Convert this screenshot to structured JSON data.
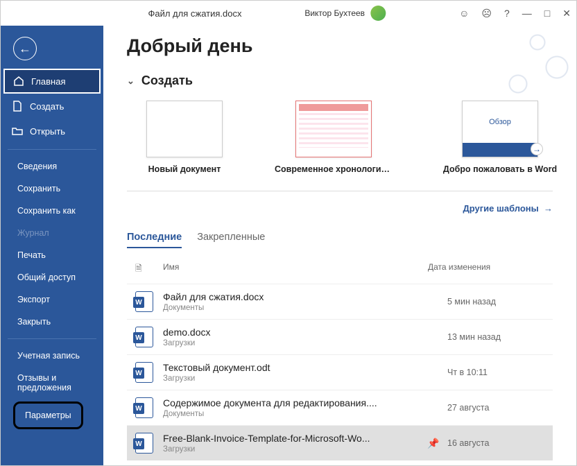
{
  "titlebar": {
    "title": "Файл для сжатия.docx",
    "user": "Виктор Бухтеев"
  },
  "sidebar": {
    "home": "Главная",
    "create": "Создать",
    "open": "Открыть",
    "info": "Сведения",
    "save": "Сохранить",
    "saveas": "Сохранить как",
    "history": "Журнал",
    "print": "Печать",
    "share": "Общий доступ",
    "export": "Экспорт",
    "close": "Закрыть",
    "account": "Учетная запись",
    "feedback": "Отзывы и предложения",
    "options": "Параметры"
  },
  "main": {
    "greeting": "Добрый день",
    "create_section": "Создать",
    "template_overview": "Обзор",
    "templates": [
      "Новый документ",
      "Современное хронологич...",
      "Добро пожаловать в Word"
    ],
    "more_templates": "Другие шаблоны",
    "tabs": {
      "recent": "Последние",
      "pinned": "Закрепленные"
    },
    "cols": {
      "name": "Имя",
      "date": "Дата изменения"
    },
    "files": [
      {
        "name": "Файл для сжатия.docx",
        "loc": "Документы",
        "date": "5 мин назад"
      },
      {
        "name": "demo.docx",
        "loc": "Загрузки",
        "date": "13 мин назад"
      },
      {
        "name": "Текстовый документ.odt",
        "loc": "Загрузки",
        "date": "Чт в 10:11"
      },
      {
        "name": "Содержимое документа для редактирования....",
        "loc": "Документы",
        "date": "27 августа"
      },
      {
        "name": "Free-Blank-Invoice-Template-for-Microsoft-Wo...",
        "loc": "Загрузки",
        "date": "16 августа"
      }
    ]
  }
}
